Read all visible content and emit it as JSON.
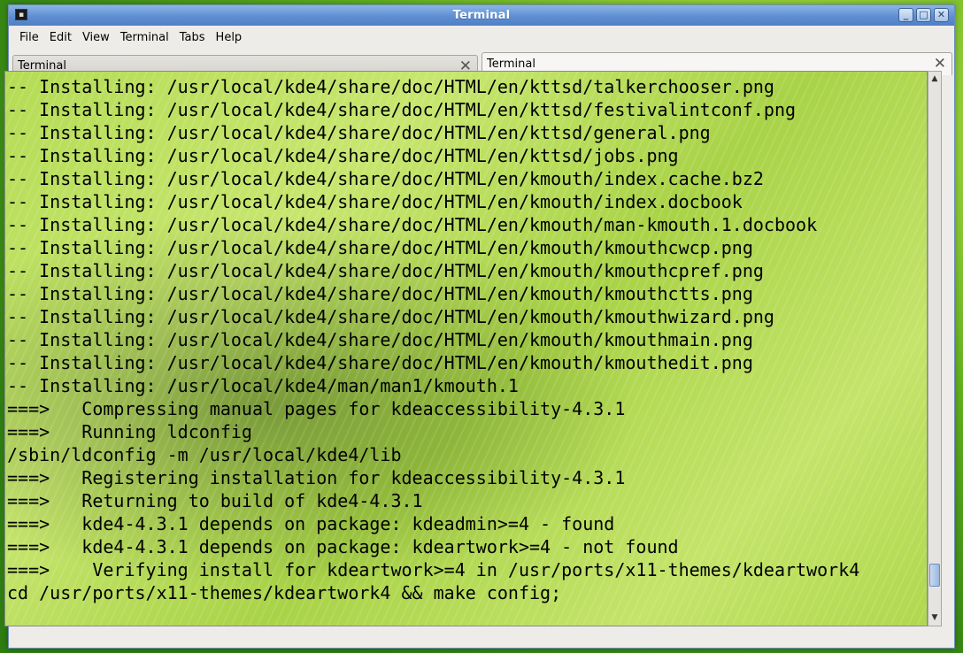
{
  "window": {
    "title": "Terminal",
    "icon": "terminal-icon",
    "controls": {
      "minimize": "_",
      "maximize": "□",
      "close": "✕"
    }
  },
  "menubar": {
    "items": [
      {
        "label": "File"
      },
      {
        "label": "Edit"
      },
      {
        "label": "View"
      },
      {
        "label": "Terminal"
      },
      {
        "label": "Tabs"
      },
      {
        "label": "Help"
      }
    ]
  },
  "tabs": [
    {
      "label": "Terminal",
      "active": false,
      "close": "✕"
    },
    {
      "label": "Terminal",
      "active": true,
      "close": "✕"
    }
  ],
  "terminal": {
    "lines": [
      "-- Installing: /usr/local/kde4/share/doc/HTML/en/kttsd/talkerchooser.png",
      "-- Installing: /usr/local/kde4/share/doc/HTML/en/kttsd/festivalintconf.png",
      "-- Installing: /usr/local/kde4/share/doc/HTML/en/kttsd/general.png",
      "-- Installing: /usr/local/kde4/share/doc/HTML/en/kttsd/jobs.png",
      "-- Installing: /usr/local/kde4/share/doc/HTML/en/kmouth/index.cache.bz2",
      "-- Installing: /usr/local/kde4/share/doc/HTML/en/kmouth/index.docbook",
      "-- Installing: /usr/local/kde4/share/doc/HTML/en/kmouth/man-kmouth.1.docbook",
      "-- Installing: /usr/local/kde4/share/doc/HTML/en/kmouth/kmouthcwcp.png",
      "-- Installing: /usr/local/kde4/share/doc/HTML/en/kmouth/kmouthcpref.png",
      "-- Installing: /usr/local/kde4/share/doc/HTML/en/kmouth/kmouthctts.png",
      "-- Installing: /usr/local/kde4/share/doc/HTML/en/kmouth/kmouthwizard.png",
      "-- Installing: /usr/local/kde4/share/doc/HTML/en/kmouth/kmouthmain.png",
      "-- Installing: /usr/local/kde4/share/doc/HTML/en/kmouth/kmouthedit.png",
      "-- Installing: /usr/local/kde4/man/man1/kmouth.1",
      "===>   Compressing manual pages for kdeaccessibility-4.3.1",
      "===>   Running ldconfig",
      "/sbin/ldconfig -m /usr/local/kde4/lib",
      "===>   Registering installation for kdeaccessibility-4.3.1",
      "===>   Returning to build of kde4-4.3.1",
      "===>   kde4-4.3.1 depends on package: kdeadmin>=4 - found",
      "===>   kde4-4.3.1 depends on package: kdeartwork>=4 - not found",
      "===>    Verifying install for kdeartwork>=4 in /usr/ports/x11-themes/kdeartwork4",
      "cd /usr/ports/x11-themes/kdeartwork4 && make config;"
    ]
  },
  "scrollbar": {
    "up_arrow": "▲",
    "down_arrow": "▼"
  }
}
